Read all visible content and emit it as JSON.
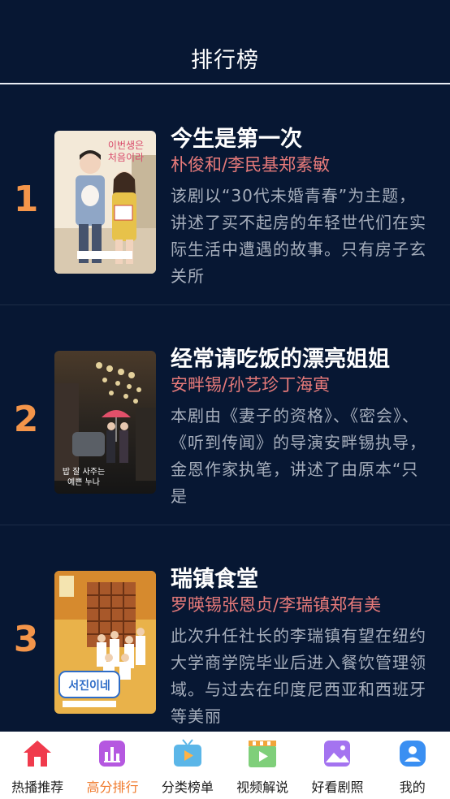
{
  "header": {
    "title": "排行榜"
  },
  "items": [
    {
      "rank": "1",
      "title": "今生是第一次",
      "cast": "朴俊和/李民基郑素敏",
      "description": "该剧以“30代未婚青春”为主题，讲述了买不起房的年轻世代们在实际生活中遭遇的故事。只有房子玄关所",
      "poster_text": "이번생은 처음이라"
    },
    {
      "rank": "2",
      "title": "经常请吃饭的漂亮姐姐",
      "cast": "安畔锡/孙艺珍丁海寅",
      "description": "本剧由《妻子的资格》、《密会》、《听到传闻》的导演安畔锡执导，金恩作家执笔，讲述了由原本“只是",
      "poster_text": "밥 잘 사주는 예쁜 누나"
    },
    {
      "rank": "3",
      "title": "瑞镇食堂",
      "cast": "罗暎锡张恩贞/李瑞镇郑有美",
      "description": "此次升任社长的李瑞镇有望在纽约大学商学院毕业后进入餐饮管理领域。与过去在印度尼西亚和西班牙等美丽",
      "poster_text": "서진이네"
    }
  ],
  "tabs": [
    {
      "label": "热播推荐",
      "icon": "home-icon",
      "active": false
    },
    {
      "label": "高分排行",
      "icon": "chart-icon",
      "active": true
    },
    {
      "label": "分类榜单",
      "icon": "tv-icon",
      "active": false
    },
    {
      "label": "视频解说",
      "icon": "film-icon",
      "active": false
    },
    {
      "label": "好看剧照",
      "icon": "photo-icon",
      "active": false
    },
    {
      "label": "我的",
      "icon": "user-icon",
      "active": false
    }
  ],
  "colors": {
    "background": "#071733",
    "rank": "#f4954a",
    "cast": "#e77a7a",
    "description": "#a6aebc",
    "tab_active": "#f07a2c"
  }
}
